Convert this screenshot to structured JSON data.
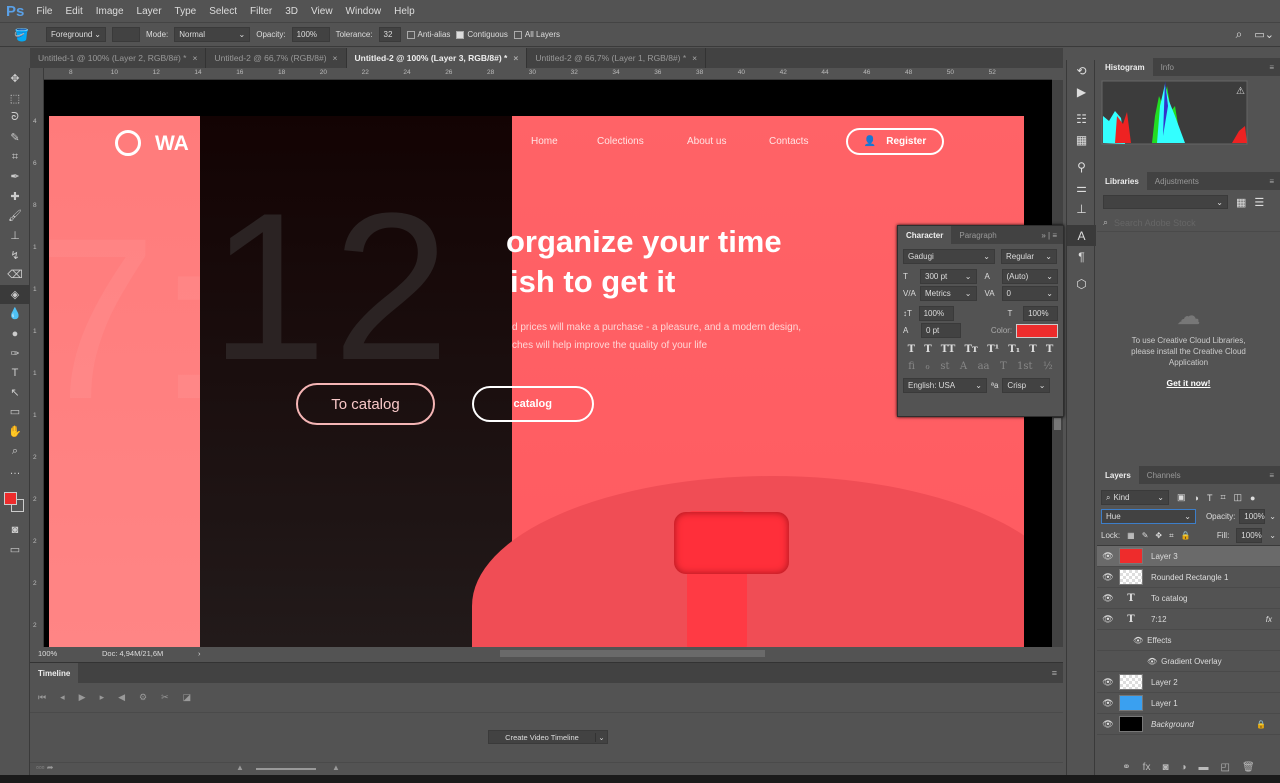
{
  "app": {
    "logo": "Ps",
    "menu": [
      "File",
      "Edit",
      "Image",
      "Layer",
      "Type",
      "Select",
      "Filter",
      "3D",
      "View",
      "Window",
      "Help"
    ]
  },
  "options": {
    "fill_source": "Foreground",
    "mode_label": "Mode:",
    "mode": "Normal",
    "opacity_label": "Opacity:",
    "opacity": "100%",
    "tolerance_label": "Tolerance:",
    "tolerance": "32",
    "anti_alias": "Anti-alias",
    "contiguous": "Contiguous",
    "all_layers": "All Layers"
  },
  "tabs": [
    {
      "label": "Untitled-1 @ 100% (Layer 2, RGB/8#) *"
    },
    {
      "label": "Untitled-2 @ 66,7% (RGB/8#)"
    },
    {
      "label": "Untitled-2 @ 100% (Layer 3, RGB/8#) *",
      "active": true
    },
    {
      "label": "Untitled-2 @ 66,7% (Layer 1, RGB/8#) *"
    }
  ],
  "ruler": {
    "h": [
      "8",
      "10",
      "12",
      "14",
      "16",
      "18",
      "20",
      "22",
      "24",
      "26",
      "28",
      "30",
      "32",
      "34",
      "36",
      "38",
      "40",
      "42",
      "44",
      "46",
      "48",
      "50",
      "52"
    ],
    "v": [
      "4",
      "6",
      "8",
      "1",
      "1",
      "1",
      "1",
      "1",
      "2",
      "2",
      "2",
      "2",
      "2"
    ]
  },
  "design": {
    "logo_text": "WA",
    "nav": [
      "Home",
      "Colections",
      "About us",
      "Contacts"
    ],
    "register": "Register",
    "big_number": "12",
    "big_left": "7:",
    "headline1": "organize your time",
    "headline2": "ish to get it",
    "body1": "d prices will make a purchase - a pleasure, and a modern design,",
    "body2": "ches will help improve the quality of your life",
    "catalog_dark": "To catalog",
    "catalog_pink": "catalog"
  },
  "status": {
    "zoom": "100%",
    "doc": "Doc: 4,94M/21,6M"
  },
  "timeline": {
    "title": "Timeline",
    "create": "Create Video Timeline"
  },
  "histogram": {
    "tabs": [
      "Histogram",
      "Info"
    ]
  },
  "libraries": {
    "tabs": [
      "Libraries",
      "Adjustments"
    ],
    "search_placeholder": "Search Adobe Stock",
    "message": "To use Creative Cloud Libraries, please install the Creative Cloud Application",
    "cta": "Get it now!"
  },
  "character": {
    "tabs": [
      "Character",
      "Paragraph"
    ],
    "font": "Gadugi",
    "style": "Regular",
    "size": "300 pt",
    "leading": "(Auto)",
    "kerning": "Metrics",
    "tracking": "0",
    "vscale": "100%",
    "hscale": "100%",
    "baseline": "0 pt",
    "color_label": "Color:",
    "color": "#ee2c2c",
    "language": "English: USA",
    "antialias": "Crisp",
    "glyphs1": [
      "T",
      "T",
      "TT",
      "Tт",
      "T¹",
      "T₁",
      "T",
      "T"
    ],
    "glyphs2": [
      "fi",
      "ℴ",
      "st",
      "A",
      "aa",
      "T",
      "1st",
      "½"
    ]
  },
  "layers": {
    "tabs": [
      "Layers",
      "Channels"
    ],
    "filter": "Kind",
    "blend": "Hue",
    "opacity_label": "Opacity:",
    "opacity": "100%",
    "lock_label": "Lock:",
    "fill_label": "Fill:",
    "fill": "100%",
    "items": [
      {
        "name": "Layer 3",
        "thumb": "red",
        "selected": true
      },
      {
        "name": "Rounded Rectangle 1",
        "thumb": "checker"
      },
      {
        "name": "To catalog",
        "thumb": "text"
      },
      {
        "name": "7:12",
        "thumb": "text",
        "fx": "fx"
      },
      {
        "name": "Effects",
        "sub": 1
      },
      {
        "name": "Gradient Overlay",
        "sub": 2
      },
      {
        "name": "Layer 2",
        "thumb": "checker"
      },
      {
        "name": "Layer 1",
        "thumb": "blue"
      },
      {
        "name": "Background",
        "thumb": "black",
        "locked": true
      }
    ]
  }
}
